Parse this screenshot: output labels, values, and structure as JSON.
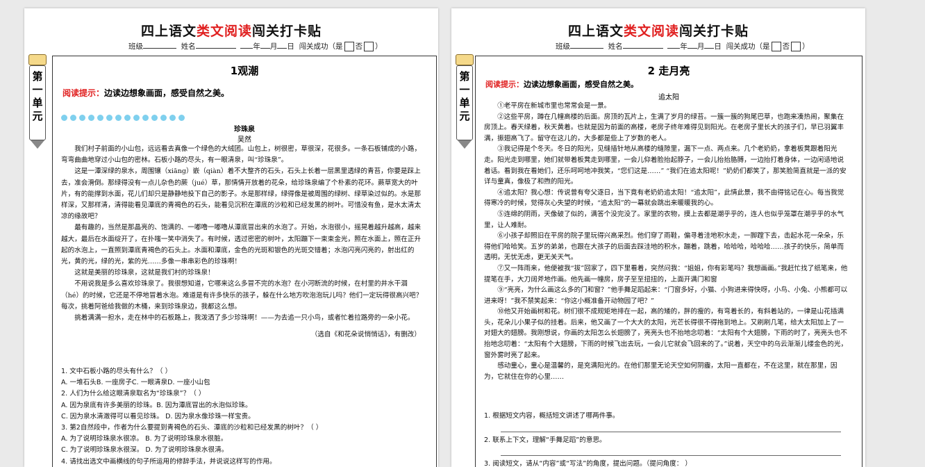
{
  "doc_title": {
    "pre": "四上语文",
    "red": "类文阅读",
    "post": "闯关打卡贴"
  },
  "meta": {
    "class_label": "班级",
    "name_label": "姓名",
    "year": "年",
    "month": "月",
    "day": "日",
    "success_label": "闯关成功（是",
    "no_label": "否",
    "close": "）"
  },
  "unit_tab": "第一单元",
  "page1": {
    "lesson": "1观潮",
    "tip_label": "阅读提示：",
    "tip_text": "边读边想象画面，感受自然之美。",
    "article_title": "珍珠泉",
    "author": "吴然",
    "paras": [
      "我们村子前面的小山包，远远看去真像一个绿色的大绒团。山包上，树很密，草很深，花很多。一条石板铺成的小路，弯弯曲曲地穿过小山包的密林。石板小路的尽头，有一眼清泉，叫“珍珠泉”。",
      "这是一潭深绿的泉水，周围镶（xiāng）嵌（qiàn）着不大整齐的石头，石头上长着一层黑里透绿的青苔，你要是踩上去，准会滑倒。那绿得没有一点儿杂色的蕨（jué）草，那情情开放着的花朵，给珍珠泉编了个朴素的花环。蕨草宽大的叶片，有的能撑到水面，花儿们却只是静静地投下自己的影子。水是那样绿，绿得像是被周围的绿树、绿草染过似的。水是那样深，又那样清，清得能看见潭底的青褐色的石头，能看见沉积在潭底的沙粒和已经发黑的树叶。可惜没有鱼，是水太清太凉的缘故吧？",
      "最有趣的，当然是那晶亮的、饱满的、一嘟噜一嘟噜从潭底冒出来的水泡了。开始，水泡很小，摇晃着越升越高，越来越大，最后在水面绽开了，在扑嗤一笑中消失了。有时候，透过密密的树叶，太阳蹦下一束束金光，照在水面上，照在正升起的水泡上，一直照到潭底青褐色的石头上。水面和潭底，金色的光斑和银色的光斑交错着；水泡闪亮闪亮的，射出红的光，黄的光，绿的光，紫的光……多像一串串彩色的珍珠啊！",
      "这就是美丽的珍珠泉，这就是我们村的珍珠泉！",
      "不用说我是多么喜欢珍珠泉了。我很想知道，它哪来这么多冒不完的水泡？在小河断流的时候，在村里的井水干涸（hé）的时候，它还是不停地冒着水泡。难道是有许多快乐的孩子，躲在什么地方吹泡泡玩儿吗？他们一定玩得很高兴吧？每次，挑着阿爸给我做的木桶，来到珍珠泉边，我都这么想。",
      "挑着满满一担水，走在林中的石板路上，我泼洒了多少珍珠啊！——为去追一只小鸟，或者忙着拉路旁的一朵小花。"
    ],
    "source": "（选自《和花朵说悄悄话》，有删改）",
    "questions": [
      "1. 文中石板小路的尽头有什么？（    ）",
      "A. 一堆石头B. 一座房子C. 一眼清泉D. 一座小山包",
      "2. 人们为什么给这眼清泉取名为“珍珠泉”？（    ）",
      "A. 因为泉底有许多美丽的珍珠。B. 因为潭底冒出的水泡似珍珠。",
      "C. 因为泉水清澈得可以看见珍珠。  D. 因为泉水像珍珠一样宝贵。",
      "3. 第2自然段中，作者为什么要提到青褐色的石头、潭底的沙粒和已经发黑的树叶？（    ）",
      "A. 为了说明珍珠泉水很凉。 B. 为了说明珍珠泉水很脏。",
      "C. 为了说明珍珠泉水很深。 D. 为了说明珍珠泉水很清。",
      "4. 请找出选文中画横线的句子所运用的修辞手法，并说说这样写的作用。"
    ]
  },
  "page2": {
    "lesson": "2 走月亮",
    "tip_label": "阅读提示：",
    "tip_text": "边读边想象画面，感受自然之美。",
    "article_title": "追太阳",
    "paras": [
      "①老平房在新城市里也常常会是一景。",
      "②这些平房，蹲在几幢高楼的后面。房顶的瓦片上，生满了岁月的绿苔。一簇一簇的狗尾巴草，也跑来凑热闹，聚集在房顶上。春天绿着，秋天黄着。也就是因为前面的高楼，老房子终年难得见到阳光。在老房子里长大的孩子们，早已羽翼丰满，振翅高飞了。留守在这儿的，大多都是些上了岁数的老人。",
      "③我记得是个冬天。冬日的阳光，见缝插针地从高楼的缝隙里，漏下一点、两点来。几个老奶奶，拿着板凳跟着阳光走。阳光走到哪里，她们就带着板凳走到哪里，一会儿仰着脸抬起脖子，一会儿抬抬胳膊，一边抬打着身体，一边闲适地说着话。看到我在看她们，还乐呵呵地冲我笑，“您们这是……” “我们在追太阳呢！”奶奶们都笑了，那笑脸简直就是一派的安详与童真，像极了和煦的阳光。",
      "④追太阳？我心想：传说曾有夸父逐日，当下竟有老奶奶追太阳！“追太阳”，此情此景，我不由得铭记在心。每当我觉得寒冷的时候，觉得灰心失望的时候，“追太阳”的一幕就会跳出来暖暖我的心。",
      "⑤连绵的阴雨，天像破了似的，满答个没完没了。家里的衣物，摸上去都是潮乎乎的，连人也似乎笼罩在潮乎乎的水气里，让人难耐。",
      "⑥小孩子却照旧在平房的院子里玩得兴高采烈。他们穿了雨鞋，偏寻着洼地积水走，一脚蹚下去，击起水花一朵朵，乐得他们哈哈笑。五岁的弟弟，也跟在大孩子的后面去踩洼地的积水，蹦着，跳着，哈哈哈，哈哈哈……孩子的快乐，简单而透明，无忧无虑，更无关天气。",
      "⑦又一阵雨来，他便被我“拔”回家了，四下里看着，突然问我：“姐姐，你有彩笔吗？我想画画。”我赶忙找了纸笔来，他提笔在手，大刀阔斧地作画。他先画一幢房，房子至至扭扭的，上面开满门和窗",
      "⑨“亮亮，为什么画这么多的门和窗？”他手舞足蹈起来：“门窗多好，小猫、小狗进来得快呀，小鸟、小兔、小熊都可以进来呀！”我不禁笑起来：“你这小概准备开动物园了吧？”",
      "⑩他又开始画树和花。树们很不成规矩地排在一起，高的矮的，胖的瘦的，有弯着长的，有斜着站的，一律是山花插满头，花朵儿小果子似的挂着。后来，他又画了一个大大的太阳，光芒长得很不得拖到地上。又刷刷几笔，给大太阳加上了一对翅大的翅膀。我刚想说，你画的太阳怎么长翅膀了，亮亮头也不抬地念叨着：“太阳有个大翅膀，下雨的时了，亮亮头也不抬地念叨着：“太阳有个大翅膀，下雨的时候飞出去玩，一会儿它就会飞回来的了。”说着，天空中的乌云渐渐儿缕金色的光，窗外雾时亮了起来。",
      "感动童心，童心是温馨的，是充满阳光的。在他们那里无论天空如何阴霾，太阳一直都在，不在这里，就在那里，因为，它就住在你的心里……"
    ],
    "questions": [
      "1. 根据短文内容，概括短文讲述了哪两件事。",
      "2. 联系上下文，理解“手舞足蹈”的意思。",
      "3. 阅读短文，请从“内容”或“写法”的角度，提出问题。（提问角度：          ）"
    ]
  }
}
